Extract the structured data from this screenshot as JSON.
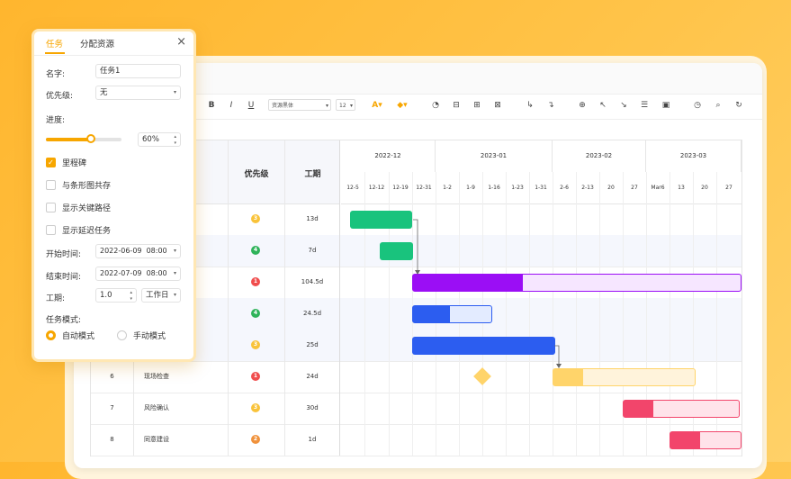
{
  "colors": {
    "accent": "#f7a600",
    "green": "#19c37d",
    "purple": "#9b0ef5",
    "blue": "#2c5df0",
    "yellow": "#ffd46a",
    "red": "#f2456b"
  },
  "toolbar": {
    "bold": "B",
    "italic": "I",
    "underline": "U",
    "font_family": "资源黑体",
    "font_size": "12"
  },
  "table": {
    "headers": {
      "priority": "优先级",
      "duration": "工期"
    },
    "rows": [
      {
        "id": "",
        "name": "",
        "priority": "3",
        "duration": "13d"
      },
      {
        "id": "",
        "name": "",
        "priority": "4",
        "duration": "7d"
      },
      {
        "id": "",
        "name": "",
        "priority": "1",
        "duration": "104.5d"
      },
      {
        "id": "",
        "name": "",
        "priority": "4",
        "duration": "24.5d"
      },
      {
        "id": "",
        "name": "",
        "priority": "3",
        "duration": "25d"
      },
      {
        "id": "6",
        "name": "现场检查",
        "priority": "1",
        "duration": "24d"
      },
      {
        "id": "7",
        "name": "风险确认",
        "priority": "3",
        "duration": "30d"
      },
      {
        "id": "8",
        "name": "同意建设",
        "priority": "2",
        "duration": "1d"
      }
    ]
  },
  "gantt": {
    "months": [
      "2022-12",
      "2023-01",
      "2023-02",
      "2023-03"
    ],
    "weeks": [
      "12-5",
      "12-12",
      "12-19",
      "12-31",
      "1-2",
      "1-9",
      "1-16",
      "1-23",
      "1-31",
      "2-6",
      "2-13",
      "20",
      "27",
      "Mar6",
      "13",
      "20",
      "27"
    ]
  },
  "panel": {
    "tabs": {
      "task": "任务",
      "resources": "分配资源"
    },
    "name_label": "名字:",
    "name_value": "任务1",
    "priority_label": "优先级:",
    "priority_value": "无",
    "progress_label": "进度:",
    "progress_value": "60%",
    "progress_fraction": 0.6,
    "checkboxes": [
      {
        "label": "里程碑",
        "checked": true
      },
      {
        "label": "与条形图共存",
        "checked": false
      },
      {
        "label": "显示关键路径",
        "checked": false
      },
      {
        "label": "显示延迟任务",
        "checked": false
      }
    ],
    "start_label": "开始时间:",
    "start_value": "2022-06-09  08:00",
    "end_label": "结束时间:",
    "end_value": "2022-07-09  08:00",
    "duration_label": "工期:",
    "duration_value": "1.0",
    "duration_unit": "工作日",
    "mode_label": "任务模式:",
    "mode_auto": "自动模式",
    "mode_manual": "手动模式"
  }
}
